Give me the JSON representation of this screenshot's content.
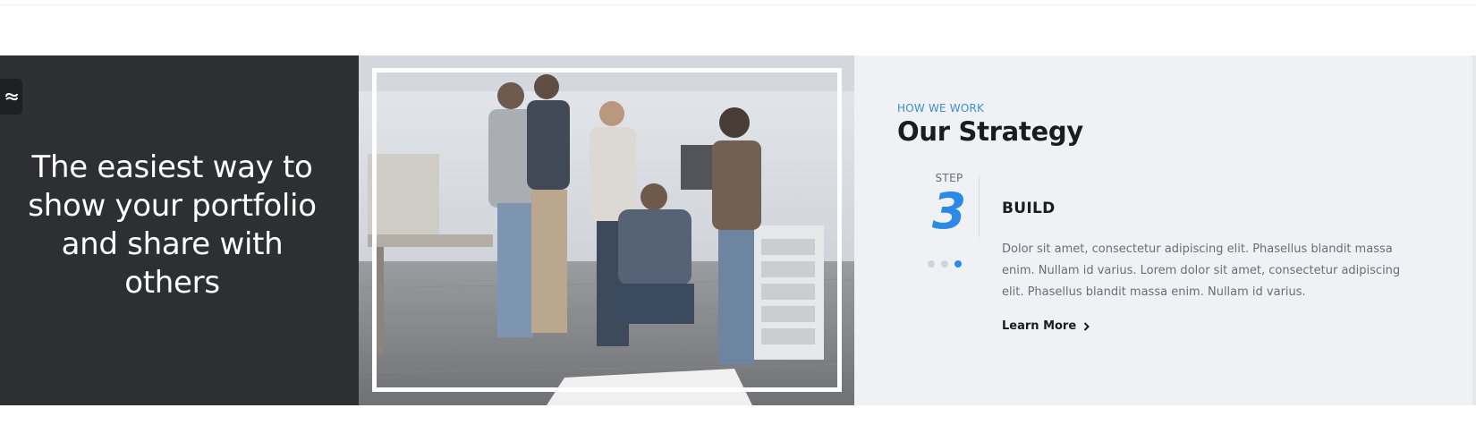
{
  "hero": {
    "tagline": "The easiest way to show your portfolio and share with others"
  },
  "side_tab": {
    "icon": "link-icon"
  },
  "photo": {
    "subject": "team-photo"
  },
  "strategy": {
    "overline": "HOW WE WORK",
    "title": "Our Strategy",
    "step_label": "STEP",
    "step_number": "3",
    "step_title": "BUILD",
    "step_text": "Dolor sit amet, consectetur adipiscing elit. Phasellus blandit massa enim. Nullam id varius. Lorem dolor sit amet, consectetur adipiscing elit. Phasellus blandit massa enim. Nullam id varius.",
    "learn_more": "Learn More",
    "learn_more_icon": "chevron-right-icon",
    "steps_total": 3,
    "active_step": 3
  },
  "colors": {
    "dark_panel": "#2d2f33",
    "light_panel": "#f0f1f4",
    "accent": "#2c8ae6"
  }
}
